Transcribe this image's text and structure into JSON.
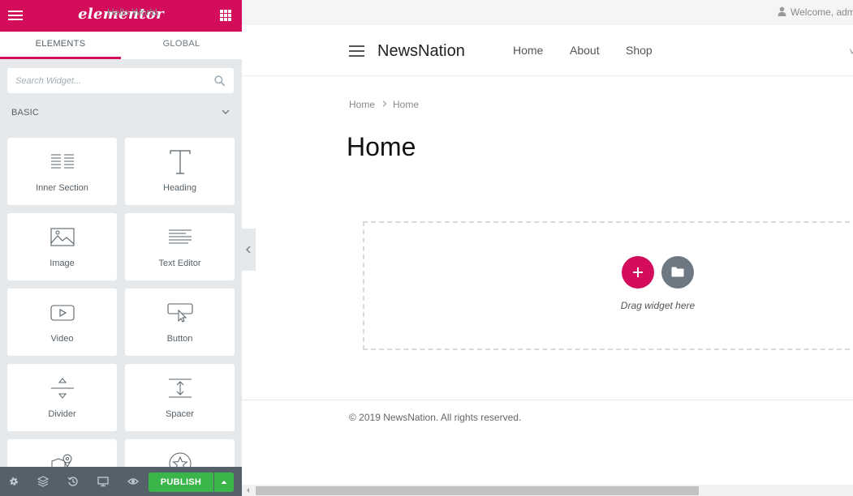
{
  "colors": {
    "brand": "#d30c5c",
    "panel_bg": "#e6e9ec",
    "footer_bg": "#556068",
    "publish": "#39b54a",
    "template_btn": "#6d7882"
  },
  "panel": {
    "logo": "elementor",
    "tabs": [
      {
        "label": "ELEMENTS",
        "active": true
      },
      {
        "label": "GLOBAL",
        "active": false
      }
    ],
    "search": {
      "placeholder": "Search Widget...",
      "value": ""
    },
    "category": "BASIC",
    "widgets": [
      {
        "label": "Inner Section",
        "icon": "inner-section-icon"
      },
      {
        "label": "Heading",
        "icon": "heading-icon"
      },
      {
        "label": "Image",
        "icon": "image-icon"
      },
      {
        "label": "Text Editor",
        "icon": "text-editor-icon"
      },
      {
        "label": "Video",
        "icon": "video-icon"
      },
      {
        "label": "Button",
        "icon": "button-icon"
      },
      {
        "label": "Divider",
        "icon": "divider-icon"
      },
      {
        "label": "Spacer",
        "icon": "spacer-icon"
      },
      {
        "label": "",
        "icon": "google-maps-icon"
      },
      {
        "label": "",
        "icon": "star-icon"
      }
    ],
    "footer": {
      "icons": [
        "settings-icon",
        "navigator-icon",
        "history-icon",
        "responsive-mode-icon",
        "preview-icon"
      ],
      "publish_label": "PUBLISH"
    }
  },
  "site": {
    "topbar_text": "Hello World.",
    "welcome_text": "Welcome, adm",
    "title": "NewsNation",
    "nav": [
      "Home",
      "About",
      "Shop"
    ],
    "nav_edge": "y",
    "breadcrumb": [
      "Home",
      "Home"
    ],
    "page_title": "Home",
    "drop_label": "Drag widget here",
    "copyright": "© 2019 NewsNation. All rights reserved."
  }
}
